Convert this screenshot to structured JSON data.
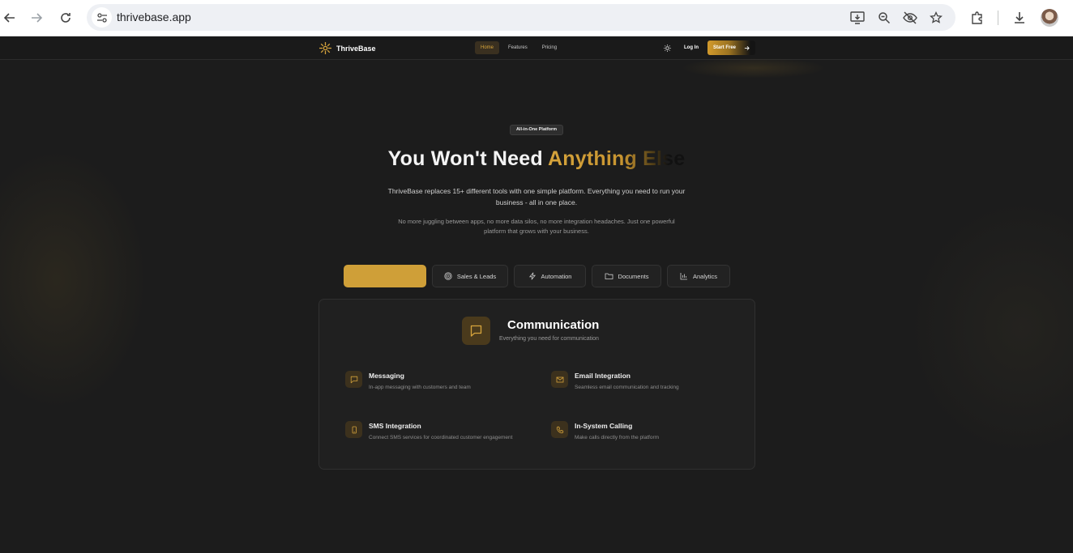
{
  "browser": {
    "url": "thrivebase.app"
  },
  "nav": {
    "brand": "ThriveBase",
    "menu": [
      {
        "label": "Home",
        "active": true
      },
      {
        "label": "Features",
        "active": false
      },
      {
        "label": "Pricing",
        "active": false
      }
    ],
    "login_label": "Log In",
    "cta_label": "Start Free"
  },
  "hero": {
    "badge": "All-in-One Platform",
    "title_lead": "You Won't Need",
    "title_highlight": "Anything Else",
    "subtitle": "ThriveBase replaces 15+ different tools with one simple platform. Everything you need to run your business - all in one place.",
    "subtitle2": "No more juggling between apps, no more data silos, no more integration headaches. Just one powerful platform that grows with your business."
  },
  "tabs": [
    {
      "label": "",
      "active": true,
      "icon": "chat-icon"
    },
    {
      "label": "Sales & Leads",
      "active": false,
      "icon": "target-icon"
    },
    {
      "label": "Automation",
      "active": false,
      "icon": "lightning-icon"
    },
    {
      "label": "Documents",
      "active": false,
      "icon": "folder-icon"
    },
    {
      "label": "Analytics",
      "active": false,
      "icon": "bar-chart-icon"
    }
  ],
  "card": {
    "title": "Communication",
    "subtitle": "Everything you need for communication",
    "features": [
      {
        "title": "Messaging",
        "desc": "In-app messaging with customers and team",
        "icon": "chat-icon"
      },
      {
        "title": "Email Integration",
        "desc": "Seamless email communication and tracking",
        "icon": "mail-icon"
      },
      {
        "title": "SMS Integration",
        "desc": "Connect SMS services for coordinated customer engagement",
        "icon": "phone-device-icon"
      },
      {
        "title": "In-System Calling",
        "desc": "Make calls directly from the platform",
        "icon": "phone-icon"
      }
    ]
  },
  "colors": {
    "accent": "#cf9f38",
    "background": "#1c1c1c",
    "card": "#202020"
  }
}
